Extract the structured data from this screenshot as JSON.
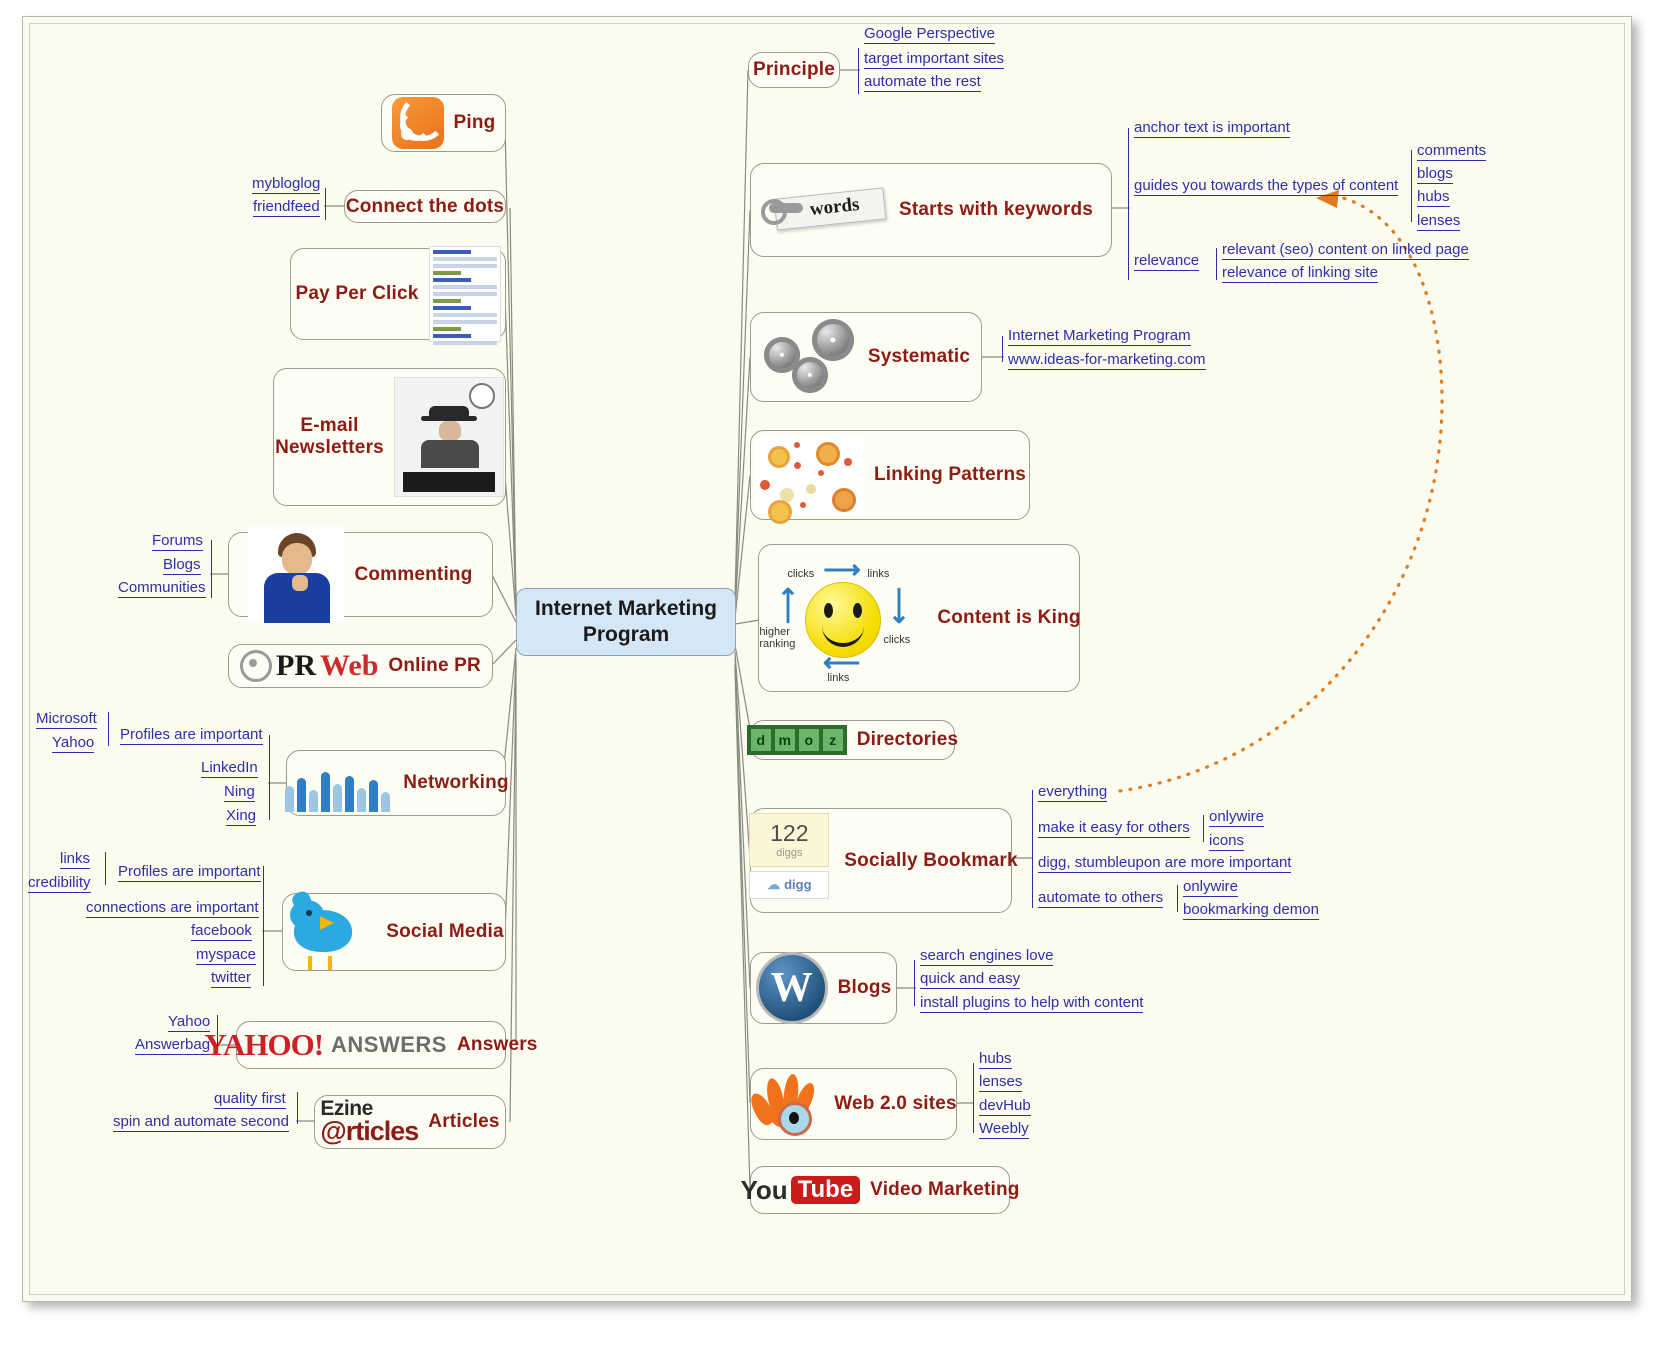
{
  "central": {
    "title": "Internet Marketing\nProgram",
    "line1": "Internet Marketing",
    "line2": "Program"
  },
  "colors": {
    "topic_text": "#8c1c15",
    "leaf_text": "#2e2ea8",
    "central_bg": "#d5e6f5",
    "canvas_bg": "#fbfbf0",
    "relationship_arrow": "#e07b20"
  },
  "right_branches": [
    {
      "label": "Principle",
      "icon": "none",
      "children": [
        {
          "label": "Google Perspective"
        },
        {
          "label": "target important sites"
        },
        {
          "label": "automate the rest"
        }
      ]
    },
    {
      "label": "Starts with keywords",
      "icon": "keywords-image",
      "children": [
        {
          "label": "anchor text is important"
        },
        {
          "label": "guides you towards the types of content",
          "children": [
            {
              "label": "comments"
            },
            {
              "label": "blogs"
            },
            {
              "label": "hubs"
            },
            {
              "label": "lenses"
            }
          ]
        },
        {
          "label": "relevance",
          "children": [
            {
              "label": "relevant (seo) content on linked page"
            },
            {
              "label": "relevance of linking site"
            }
          ]
        }
      ]
    },
    {
      "label": "Systematic",
      "icon": "gears-icon",
      "children": [
        {
          "label": "Internet Marketing Program"
        },
        {
          "label": "www.ideas-for-marketing.com"
        }
      ]
    },
    {
      "label": "Linking Patterns",
      "icon": "network-dots-image",
      "children": []
    },
    {
      "label": "Content is King",
      "icon": "smiley-cycle-image",
      "cycle_labels": [
        "clicks",
        "links",
        "clicks",
        "links",
        "higher ranking"
      ],
      "children": []
    },
    {
      "label": "Directories",
      "icon": "dmoz-logo",
      "children": []
    },
    {
      "label": "Socially Bookmark",
      "icon": "digg-counter",
      "digg_count": "122",
      "digg_word": "diggs",
      "digg_label": "digg",
      "children": [
        {
          "label": "everything"
        },
        {
          "label": "make it easy for others",
          "children": [
            {
              "label": "onlywire"
            },
            {
              "label": "icons"
            }
          ]
        },
        {
          "label": "digg, stumbleupon are more important"
        },
        {
          "label": "automate to others",
          "children": [
            {
              "label": "onlywire"
            },
            {
              "label": "bookmarking demon"
            }
          ]
        }
      ]
    },
    {
      "label": "Blogs",
      "icon": "wordpress-logo",
      "children": [
        {
          "label": "search engines love"
        },
        {
          "label": "quick and easy"
        },
        {
          "label": "install plugins to help with content"
        }
      ]
    },
    {
      "label": "Web 2.0 sites",
      "icon": "flame-eye-icon",
      "children": [
        {
          "label": "hubs"
        },
        {
          "label": "lenses"
        },
        {
          "label": "devHub"
        },
        {
          "label": "Weebly"
        }
      ]
    },
    {
      "label": "Video Marketing",
      "icon": "youtube-logo",
      "youtube_you": "You",
      "youtube_tube": "Tube",
      "children": []
    }
  ],
  "left_branches": [
    {
      "label": "Ping",
      "icon": "rss-icon",
      "children": []
    },
    {
      "label": "Connect the dots",
      "icon": "none",
      "children": [
        {
          "label": "mybloglog"
        },
        {
          "label": "friendfeed"
        }
      ]
    },
    {
      "label": "Pay Per Click",
      "icon": "serp-thumbnail",
      "children": []
    },
    {
      "label": "E-mail\nNewsletters",
      "line1": "E-mail",
      "line2": "Newsletters",
      "icon": "typewriter-photo",
      "children": []
    },
    {
      "label": "Commenting",
      "icon": "person-photo",
      "children": [
        {
          "label": "Forums"
        },
        {
          "label": "Blogs"
        },
        {
          "label": "Communities"
        }
      ]
    },
    {
      "label": "Online PR",
      "icon": "prweb-logo",
      "prweb_pr": "PR",
      "prweb_web": "Web",
      "children": []
    },
    {
      "label": "Networking",
      "icon": "crowd-image",
      "children": [
        {
          "label": "Profiles are important",
          "children": [
            {
              "label": "Microsoft"
            },
            {
              "label": "Yahoo"
            }
          ]
        },
        {
          "label": "LinkedIn"
        },
        {
          "label": "Ning"
        },
        {
          "label": "Xing"
        }
      ]
    },
    {
      "label": "Social Media",
      "icon": "twitter-bird",
      "children": [
        {
          "label": "Profiles are important",
          "children": [
            {
              "label": "links"
            },
            {
              "label": "credibility"
            }
          ]
        },
        {
          "label": "connections are important"
        },
        {
          "label": "facebook"
        },
        {
          "label": "myspace"
        },
        {
          "label": "twitter"
        }
      ]
    },
    {
      "label": "Answers",
      "icon": "yahoo-answers-logo",
      "yahoo_y": "YAHOO!",
      "yahoo_a": "ANSWERS",
      "children": [
        {
          "label": "Yahoo"
        },
        {
          "label": "Answerbag"
        }
      ]
    },
    {
      "label": "Articles",
      "icon": "ezinearticles-logo",
      "ezine_1": "Ezine",
      "ezine_2": "@rticles",
      "children": [
        {
          "label": "quality first"
        },
        {
          "label": "spin and automate second"
        }
      ]
    }
  ]
}
